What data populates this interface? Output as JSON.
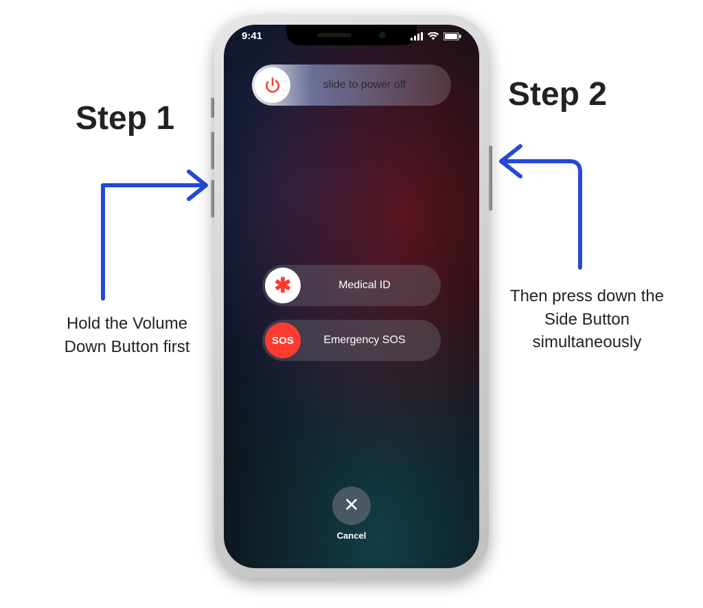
{
  "status_bar": {
    "time": "9:41"
  },
  "sliders": {
    "power_off_label": "slide to power off",
    "medical_label": "Medical ID",
    "medical_knob_glyph": "✱",
    "sos_label": "Emergency SOS",
    "sos_knob_text": "SOS"
  },
  "cancel": {
    "label": "Cancel"
  },
  "callouts": {
    "step1_title": "Step 1",
    "step1_text": "Hold the Volume Down Button first",
    "step2_title": "Step 2",
    "step2_text": "Then press down the Side Button simultaneously"
  },
  "colors": {
    "arrow": "#2449d8",
    "sos_red": "#ff3b30"
  }
}
